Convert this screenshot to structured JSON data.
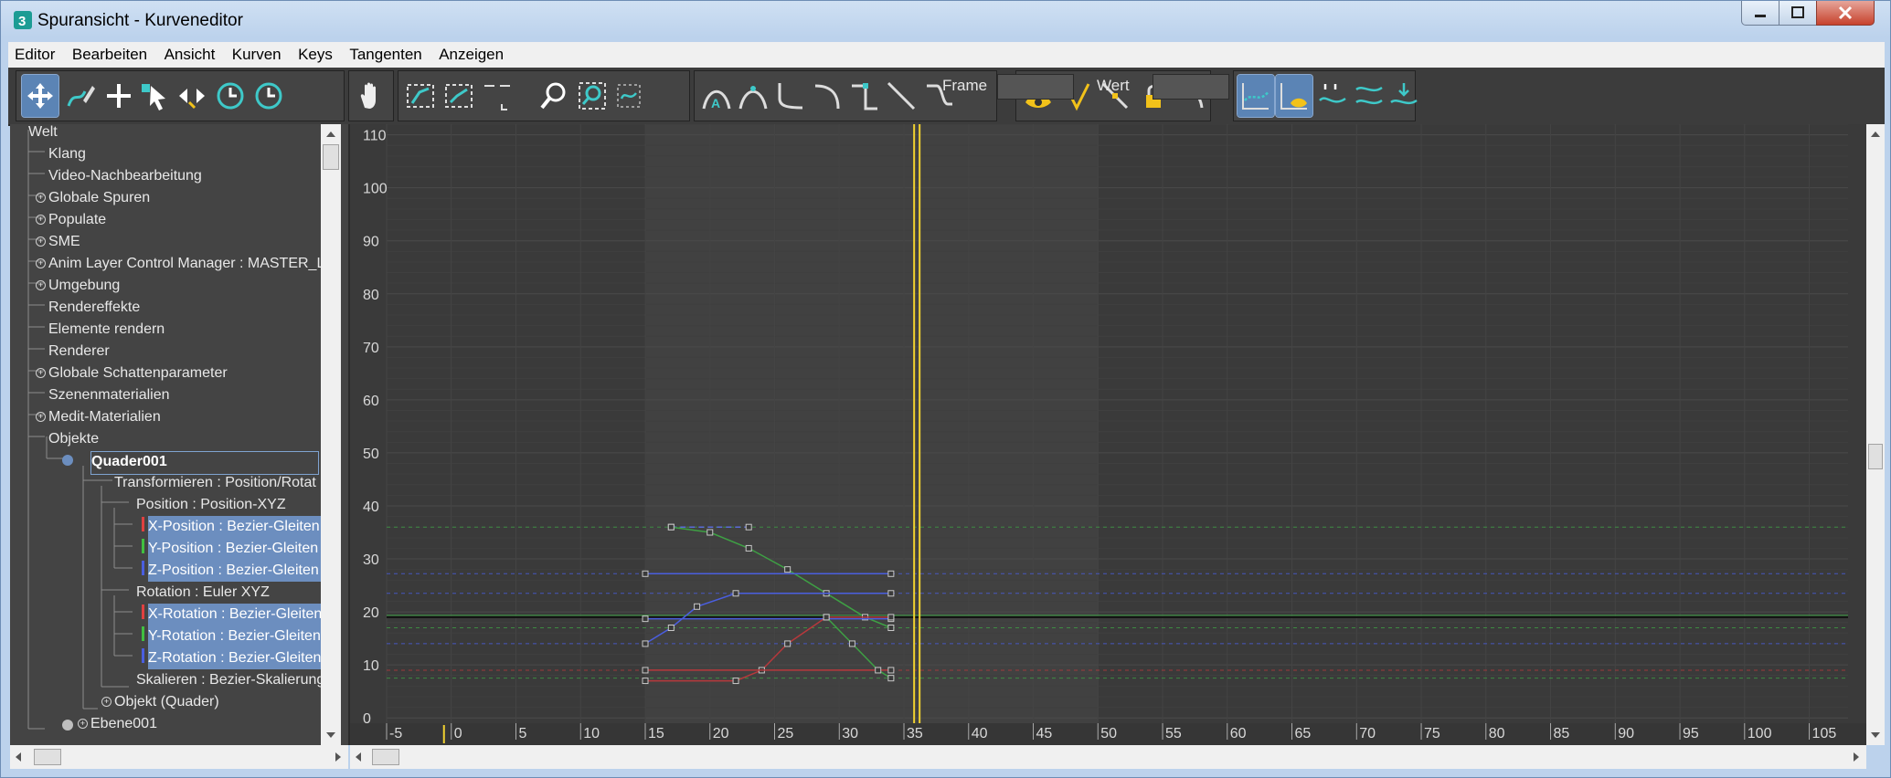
{
  "window": {
    "title": "Spuransicht - Kurveneditor",
    "app_icon": "3dsmax-icon"
  },
  "menu": [
    "Editor",
    "Bearbeiten",
    "Ansicht",
    "Kurven",
    "Keys",
    "Tangenten",
    "Anzeigen"
  ],
  "toolbar": {
    "frame_label": "Frame",
    "frame_value": "",
    "value_label": "Wert",
    "value_value": ""
  },
  "tree": {
    "items": [
      {
        "label": "Welt"
      },
      {
        "label": "Klang"
      },
      {
        "label": "Video-Nachbearbeitung"
      },
      {
        "label": "Globale Spuren",
        "expandable": true
      },
      {
        "label": "Populate",
        "expandable": true
      },
      {
        "label": "SME",
        "expandable": true
      },
      {
        "label": "Anim Layer Control Manager : MASTER_L",
        "expandable": true
      },
      {
        "label": "Umgebung",
        "expandable": true
      },
      {
        "label": "Rendereffekte"
      },
      {
        "label": "Elemente rendern"
      },
      {
        "label": "Renderer"
      },
      {
        "label": "Globale Schattenparameter",
        "expandable": true
      },
      {
        "label": "Szenenmaterialien"
      },
      {
        "label": "Medit-Materialien",
        "expandable": true
      },
      {
        "label": "Objekte"
      },
      {
        "label": "Quader001"
      },
      {
        "label": "Transformieren : Position/Rotat"
      },
      {
        "label": "Position : Position-XYZ"
      },
      {
        "label": "X-Position : Bezier-Gleiten"
      },
      {
        "label": "Y-Position : Bezier-Gleiten"
      },
      {
        "label": "Z-Position : Bezier-Gleiten"
      },
      {
        "label": "Rotation : Euler XYZ"
      },
      {
        "label": "X-Rotation : Bezier-Gleiten"
      },
      {
        "label": "Y-Rotation : Bezier-Gleiten"
      },
      {
        "label": "Z-Rotation : Bezier-Gleiten"
      },
      {
        "label": "Skalieren : Bezier-Skalierung"
      },
      {
        "label": "Objekt (Quader)",
        "expandable": true
      },
      {
        "label": "Ebene001",
        "expandable": true
      }
    ]
  },
  "chart_data": {
    "type": "line",
    "title": "",
    "xlabel": "",
    "ylabel": "",
    "x_ticks": [
      "-5",
      "0",
      "5",
      "10",
      "15",
      "20",
      "25",
      "30",
      "35",
      "40",
      "45",
      "50",
      "55",
      "60",
      "65",
      "70",
      "75",
      "80",
      "85",
      "90",
      "95",
      "100",
      "105"
    ],
    "y_ticks": [
      "0",
      "10",
      "20",
      "30",
      "40",
      "50",
      "60",
      "70",
      "80",
      "90",
      "100",
      "110"
    ],
    "xlim": [
      -5,
      108
    ],
    "ylim": [
      -1,
      112
    ],
    "current_frame": 36,
    "active_range": [
      15,
      50
    ],
    "colors": {
      "x_axis": "#d04040",
      "y_axis": "#40b040",
      "z_axis": "#4a5ee0",
      "time_slider": "#f2d230",
      "position": "#5a6cd8",
      "rotation_x": "#b8383c",
      "rotation_y": "#3ea044",
      "rotation_z": "#4a5ee0"
    },
    "series": [
      {
        "color": "#5a6cd8",
        "points": [
          [
            17,
            36
          ],
          [
            23,
            36
          ]
        ]
      },
      {
        "color": "#3ea044",
        "points": [
          [
            17,
            36
          ],
          [
            20,
            35
          ],
          [
            23,
            32
          ],
          [
            26,
            28
          ],
          [
            29,
            23.5
          ],
          [
            32,
            19
          ],
          [
            34,
            17
          ]
        ]
      },
      {
        "color": "#4a5ee0",
        "points": [
          [
            15,
            27.2
          ],
          [
            34,
            27.2
          ]
        ]
      },
      {
        "color": "#4a5ee0",
        "points": [
          [
            15,
            14
          ],
          [
            17,
            17
          ],
          [
            19,
            21
          ],
          [
            22,
            23.5
          ],
          [
            34,
            23.5
          ]
        ]
      },
      {
        "color": "#4a5ee0",
        "points": [
          [
            15,
            18.7
          ],
          [
            34,
            18.7
          ]
        ]
      },
      {
        "color": "#b8383c",
        "points": [
          [
            15,
            7
          ],
          [
            22,
            7
          ],
          [
            24,
            9
          ],
          [
            26,
            14
          ],
          [
            29,
            19
          ],
          [
            34,
            19
          ]
        ]
      },
      {
        "color": "#b8383c",
        "points": [
          [
            15,
            9
          ],
          [
            34,
            9
          ]
        ]
      },
      {
        "color": "#3ea044",
        "points": [
          [
            29,
            19
          ],
          [
            31,
            14
          ],
          [
            33,
            9
          ],
          [
            34,
            7.5
          ]
        ]
      }
    ]
  }
}
